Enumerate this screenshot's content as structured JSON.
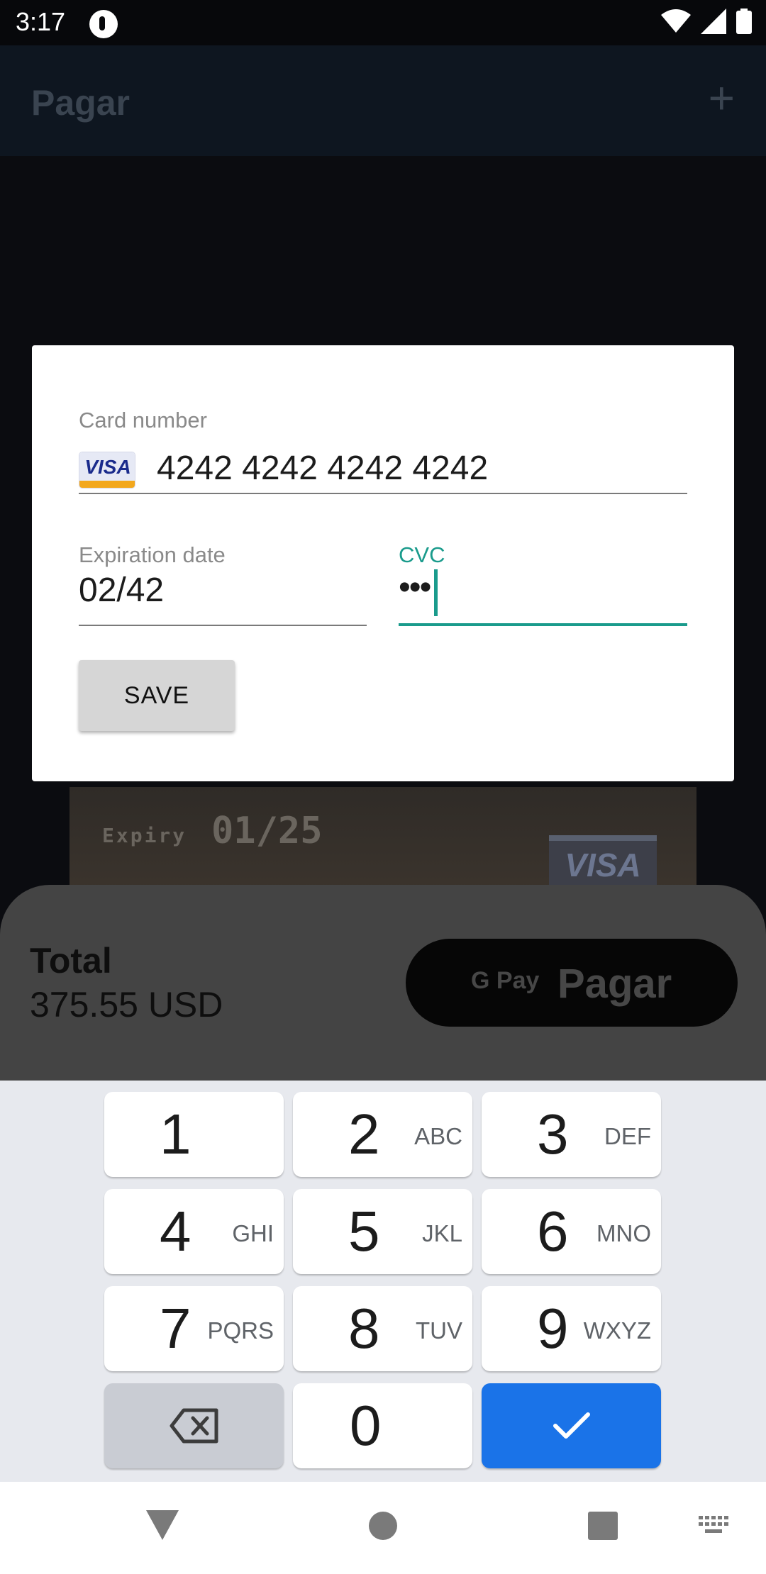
{
  "status_bar": {
    "time": "3:17"
  },
  "app_bar": {
    "title": "Pagar",
    "add_icon": "+"
  },
  "background_card": {
    "expiry_label": "Expiry",
    "expiry_value": "01/25",
    "brand": "VISA"
  },
  "bottom_sheet": {
    "total_label": "Total",
    "total_value": "375.55 USD",
    "gpay_mark": "G Pay",
    "pay_label": "Pagar"
  },
  "dialog": {
    "card_number_label": "Card number",
    "card_brand": "VISA",
    "card_number_value": "4242 4242 4242 4242",
    "expiration_label": "Expiration date",
    "expiration_value": "02/42",
    "cvc_label": "CVC",
    "cvc_value": "•••",
    "save_label": "SAVE"
  },
  "keyboard": {
    "keys": [
      {
        "num": "1",
        "letters": ""
      },
      {
        "num": "2",
        "letters": "ABC"
      },
      {
        "num": "3",
        "letters": "DEF"
      },
      {
        "num": "4",
        "letters": "GHI"
      },
      {
        "num": "5",
        "letters": "JKL"
      },
      {
        "num": "6",
        "letters": "MNO"
      },
      {
        "num": "7",
        "letters": "PQRS"
      },
      {
        "num": "8",
        "letters": "TUV"
      },
      {
        "num": "9",
        "letters": "WXYZ"
      },
      {
        "num": "0",
        "letters": ""
      }
    ]
  },
  "colors": {
    "accent_teal": "#1a9b8c",
    "done_key_blue": "#1a73e8",
    "scrim": "#0b0c10"
  },
  "icons": [
    "wifi-icon",
    "signal-icon",
    "battery-icon",
    "backspace-icon",
    "check-icon",
    "back-icon",
    "home-icon",
    "recents-icon",
    "keyboard-icon"
  ]
}
